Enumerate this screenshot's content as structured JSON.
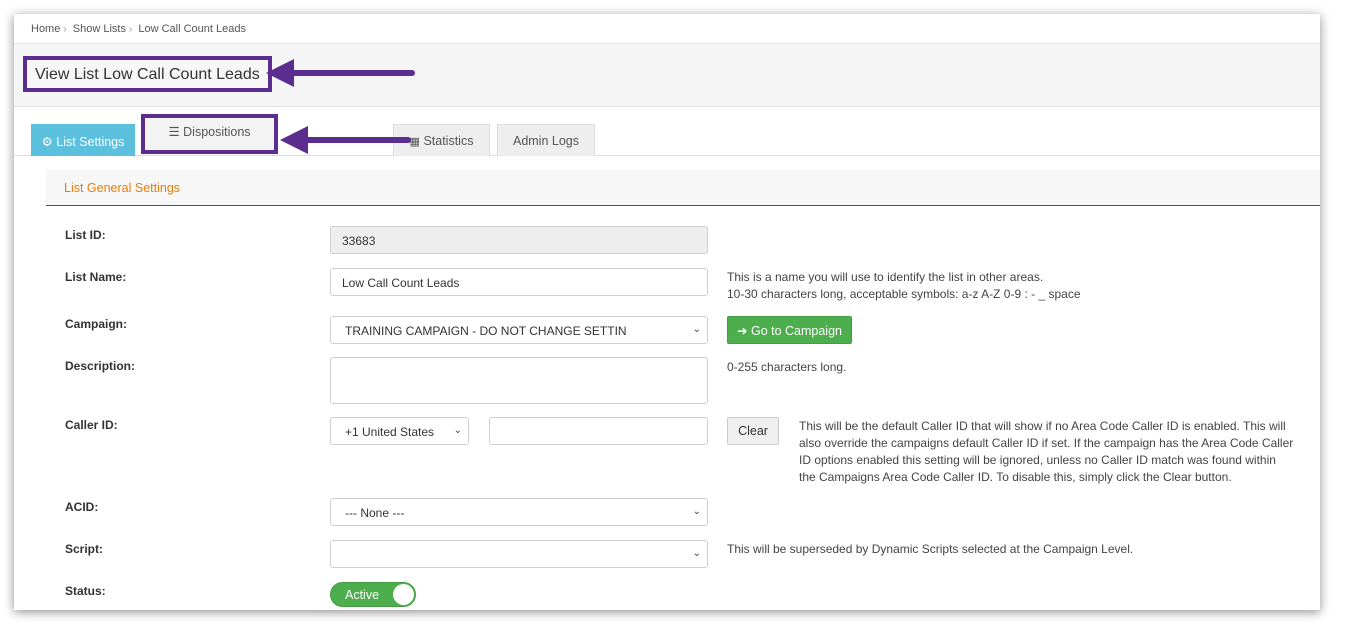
{
  "breadcrumb": {
    "items": [
      "Home",
      "Show Lists",
      "Low Call Count Leads"
    ],
    "separator": "›"
  },
  "page": {
    "title": "View List Low Call Count Leads"
  },
  "tabs": [
    {
      "label": "List Settings",
      "icon": "gear-icon",
      "active": true
    },
    {
      "label": "Dispositions",
      "icon": "list-icon",
      "active": false
    },
    {
      "label": "Statistics",
      "icon": "table-icon",
      "active": false
    },
    {
      "label": "Admin Logs",
      "icon": "",
      "active": false
    }
  ],
  "section": {
    "title": "List General Settings"
  },
  "form": {
    "list_id": {
      "label": "List ID:",
      "value": "33683"
    },
    "list_name": {
      "label": "List Name:",
      "value": "Low Call Count Leads",
      "help_line1": "This is a name you will use to identify the list in other areas.",
      "help_line2": "10-30 characters long, acceptable symbols: a-z A-Z 0-9 : - _ space"
    },
    "campaign": {
      "label": "Campaign:",
      "selected": "TRAINING CAMPAIGN - DO NOT CHANGE SETTIN",
      "button_label": "Go to Campaign"
    },
    "description": {
      "label": "Description:",
      "value": "",
      "help": "0-255 characters long."
    },
    "caller_id": {
      "label": "Caller ID:",
      "country": "+1 United States",
      "number": "",
      "clear_label": "Clear",
      "help_line1": "This will be the default Caller ID that will show if no Area Code Caller ID is enabled. This will",
      "help_line2": "also override the campaigns default Caller ID if set. If the campaign has the Area Code Caller",
      "help_line3": "ID options enabled this setting will be ignored, unless no Caller ID match was found within",
      "help_line4": "the Campaigns Area Code Caller ID. To disable this, simply click the Clear button."
    },
    "acid": {
      "label": "ACID:",
      "selected": "--- None ---"
    },
    "script": {
      "label": "Script:",
      "selected": "",
      "help": "This will be superseded by Dynamic Scripts selected at the Campaign Level."
    },
    "status": {
      "label": "Status:",
      "toggle_label": "Active",
      "on": true
    }
  },
  "colors": {
    "annotation": "#5b2d8e",
    "tab_active": "#5bc0de",
    "section_title": "#e87e0c",
    "success": "#4cae4c"
  }
}
